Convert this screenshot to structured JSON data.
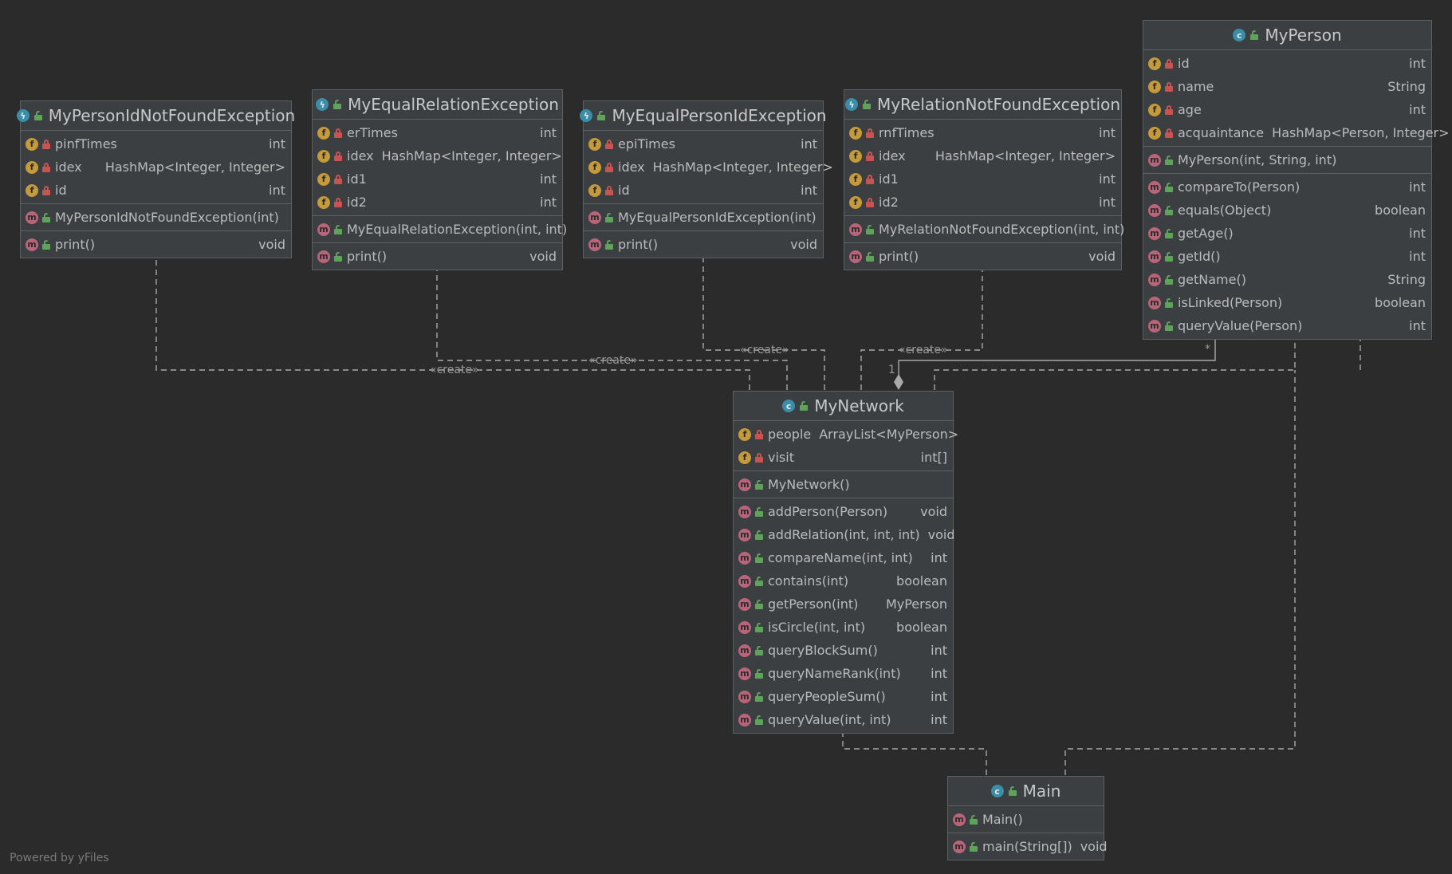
{
  "classes": {
    "pinf": {
      "title": "MyPersonIdNotFoundException",
      "fields": [
        {
          "name": "pinfTimes",
          "type": "int"
        },
        {
          "name": "idex",
          "type": "HashMap<Integer, Integer>"
        },
        {
          "name": "id",
          "type": "int"
        }
      ],
      "constructors": [
        {
          "name": "MyPersonIdNotFoundException(int)",
          "type": ""
        }
      ],
      "methods": [
        {
          "name": "print()",
          "type": "void"
        }
      ]
    },
    "er": {
      "title": "MyEqualRelationException",
      "fields": [
        {
          "name": "erTimes",
          "type": "int"
        },
        {
          "name": "idex",
          "type": "HashMap<Integer, Integer>"
        },
        {
          "name": "id1",
          "type": "int"
        },
        {
          "name": "id2",
          "type": "int"
        }
      ],
      "constructors": [
        {
          "name": "MyEqualRelationException(int, int)",
          "type": ""
        }
      ],
      "methods": [
        {
          "name": "print()",
          "type": "void"
        }
      ]
    },
    "epi": {
      "title": "MyEqualPersonIdException",
      "fields": [
        {
          "name": "epiTimes",
          "type": "int"
        },
        {
          "name": "idex",
          "type": "HashMap<Integer, Integer>"
        },
        {
          "name": "id",
          "type": "int"
        }
      ],
      "constructors": [
        {
          "name": "MyEqualPersonIdException(int)",
          "type": ""
        }
      ],
      "methods": [
        {
          "name": "print()",
          "type": "void"
        }
      ]
    },
    "rnf": {
      "title": "MyRelationNotFoundException",
      "fields": [
        {
          "name": "rnfTimes",
          "type": "int"
        },
        {
          "name": "idex",
          "type": "HashMap<Integer, Integer>"
        },
        {
          "name": "id1",
          "type": "int"
        },
        {
          "name": "id2",
          "type": "int"
        }
      ],
      "constructors": [
        {
          "name": "MyRelationNotFoundException(int, int)",
          "type": ""
        }
      ],
      "methods": [
        {
          "name": "print()",
          "type": "void"
        }
      ]
    },
    "person": {
      "title": "MyPerson",
      "fields": [
        {
          "name": "id",
          "type": "int"
        },
        {
          "name": "name",
          "type": "String"
        },
        {
          "name": "age",
          "type": "int"
        },
        {
          "name": "acquaintance",
          "type": "HashMap<Person, Integer>"
        }
      ],
      "constructors": [
        {
          "name": "MyPerson(int, String, int)",
          "type": ""
        }
      ],
      "methods": [
        {
          "name": "compareTo(Person)",
          "type": "int"
        },
        {
          "name": "equals(Object)",
          "type": "boolean"
        },
        {
          "name": "getAge()",
          "type": "int"
        },
        {
          "name": "getId()",
          "type": "int"
        },
        {
          "name": "getName()",
          "type": "String"
        },
        {
          "name": "isLinked(Person)",
          "type": "boolean"
        },
        {
          "name": "queryValue(Person)",
          "type": "int"
        }
      ]
    },
    "network": {
      "title": "MyNetwork",
      "fields": [
        {
          "name": "people",
          "type": "ArrayList<MyPerson>"
        },
        {
          "name": "visit",
          "type": "int[]"
        }
      ],
      "constructors": [
        {
          "name": "MyNetwork()",
          "type": ""
        }
      ],
      "methods": [
        {
          "name": "addPerson(Person)",
          "type": "void"
        },
        {
          "name": "addRelation(int, int, int)",
          "type": "void"
        },
        {
          "name": "compareName(int, int)",
          "type": "int"
        },
        {
          "name": "contains(int)",
          "type": "boolean"
        },
        {
          "name": "getPerson(int)",
          "type": "MyPerson"
        },
        {
          "name": "isCircle(int, int)",
          "type": "boolean"
        },
        {
          "name": "queryBlockSum()",
          "type": "int"
        },
        {
          "name": "queryNameRank(int)",
          "type": "int"
        },
        {
          "name": "queryPeopleSum()",
          "type": "int"
        },
        {
          "name": "queryValue(int, int)",
          "type": "int"
        }
      ]
    },
    "main": {
      "title": "Main",
      "fields": [],
      "constructors": [
        {
          "name": "Main()",
          "type": ""
        }
      ],
      "methods": [
        {
          "name": "main(String[])",
          "type": "void"
        }
      ]
    }
  },
  "edge_labels": {
    "create1": "«create»",
    "create2": "«create»",
    "create3": "«create»",
    "create4": "«create»",
    "mult_one": "1",
    "mult_many": "*"
  },
  "footer": "Powered by yFiles",
  "colors": {
    "background": "#2b2b2b",
    "node_fill": "#3c3f41",
    "field_badge": "#c49a3a",
    "method_badge": "#b8657a",
    "class_badge": "#3a8ea8",
    "private_lock": "#c75450",
    "public_lock": "#5fa35a"
  },
  "icons": {
    "class": "class-icon",
    "exception": "exception-class-icon",
    "field": "field-icon",
    "method": "method-icon",
    "private": "private-lock-icon",
    "public": "public-lock-icon"
  }
}
